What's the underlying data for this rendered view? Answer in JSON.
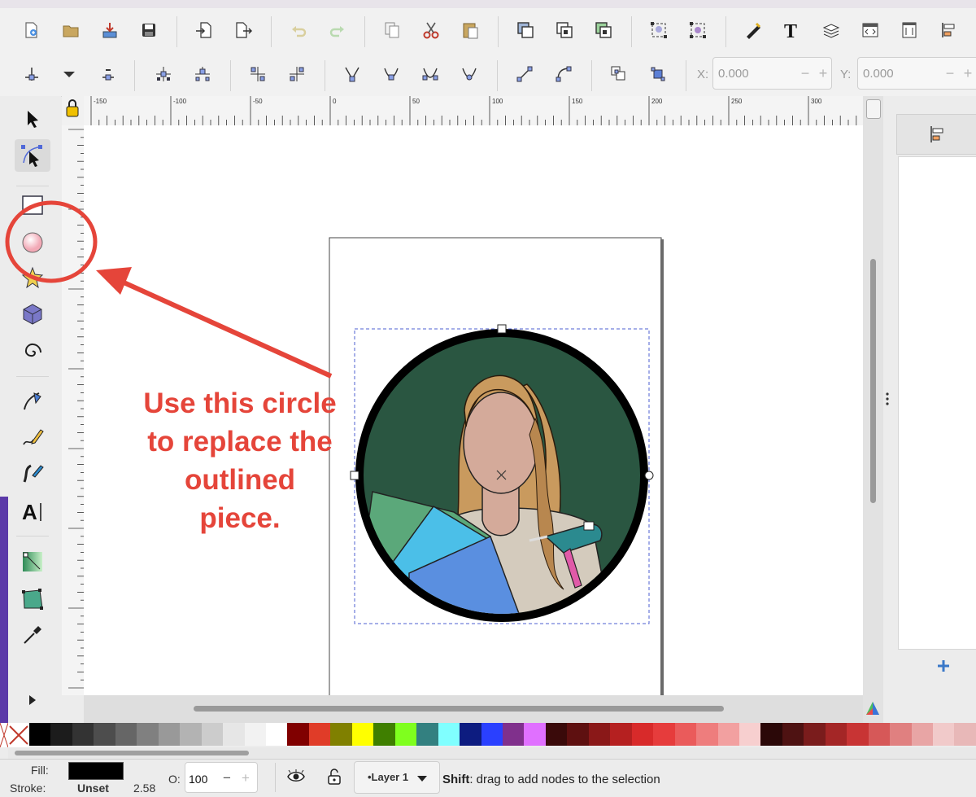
{
  "toolbar": {
    "x_label": "X:",
    "x_value": "0.000",
    "y_label": "Y:",
    "y_value": "0.000",
    "minus": "−",
    "plus": "+"
  },
  "ruler": {
    "ticks": [
      "-150",
      "-100",
      "-50",
      "0",
      "50",
      "100",
      "150",
      "200",
      "250",
      "300"
    ]
  },
  "annotation": {
    "lines": [
      "Use this circle",
      "to replace the",
      "outlined",
      "piece."
    ]
  },
  "palette": {
    "colors": [
      "#000000",
      "#1c1c1c",
      "#333333",
      "#4d4d4d",
      "#666666",
      "#808080",
      "#999999",
      "#b3b3b3",
      "#cccccc",
      "#e6e6e6",
      "#f2f2f2",
      "#ffffff",
      "#800000",
      "#e03c28",
      "#808000",
      "#ffff00",
      "#3f7f00",
      "#7fff1e",
      "#338080",
      "#80ffff",
      "#0d1c80",
      "#2a40ff",
      "#80308c",
      "#e070ff",
      "#3a0a0a",
      "#5e1010",
      "#8a1818",
      "#b52020",
      "#d82a2a",
      "#e63c3c",
      "#ea5b5b",
      "#ee7d7d",
      "#f2a0a0",
      "#f7cfcf",
      "#2b0808",
      "#4e1212",
      "#7a1c1c",
      "#a42626",
      "#c83434",
      "#d65858",
      "#e08080",
      "#e8a5a5",
      "#f1caca",
      "#e8b8b8"
    ],
    "colors_comment": "swatch colors from left to right"
  },
  "status": {
    "fill_label": "Fill:",
    "stroke_label": "Stroke:",
    "stroke_value": "Unset",
    "stroke_width": "2.58",
    "opacity_label": "O:",
    "opacity_value": "100",
    "layer": "•Layer 1",
    "hint_bold": "Shift",
    "hint_text": ": drag to add nodes to the selection",
    "fill_color": "#000000"
  },
  "colors": {
    "accent": "#e5453a",
    "circle_bg": "#2a5641",
    "skin": "#d4aa9a",
    "hair": "#c99a5e"
  }
}
